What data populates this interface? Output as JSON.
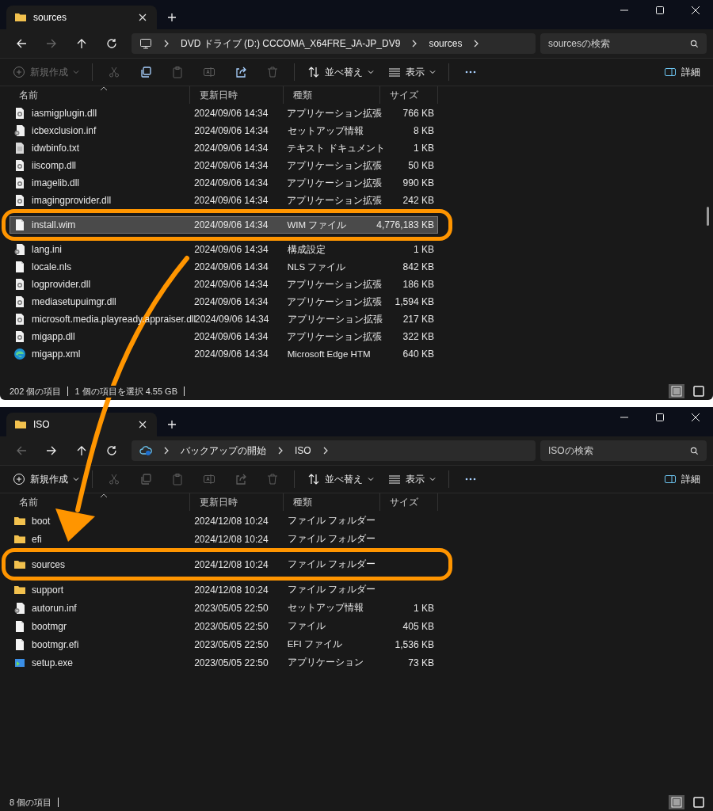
{
  "windows": [
    {
      "tab": {
        "title": "sources"
      },
      "back_disabled": false,
      "forward_disabled": true,
      "address": {
        "kind": "pc",
        "items": [
          "DVD ドライブ (D:) CCCOMA_X64FRE_JA-JP_DV9",
          "sources"
        ]
      },
      "search": {
        "placeholder": "sourcesの検索"
      },
      "toolbar": {
        "new": {
          "label": "新規作成",
          "disabled": true
        },
        "actions": [
          {
            "kind": "cut",
            "disabled": true
          },
          {
            "kind": "copy",
            "disabled": false
          },
          {
            "kind": "paste",
            "disabled": true
          },
          {
            "kind": "rename",
            "disabled": true
          },
          {
            "kind": "share",
            "disabled": false
          },
          {
            "kind": "delete",
            "disabled": true
          }
        ],
        "sort": "並べ替え",
        "view": "表示",
        "details": "詳細"
      },
      "columns": [
        "名前",
        "更新日時",
        "種類",
        "サイズ"
      ],
      "rows": [
        {
          "kind": "dll",
          "name": "iasmigplugin.dll",
          "date": "2024/09/06 14:34",
          "type": "アプリケーション拡張",
          "size": "766 KB",
          "selected": false
        },
        {
          "kind": "setup",
          "name": "icbexclusion.inf",
          "date": "2024/09/06 14:34",
          "type": "セットアップ情報",
          "size": "8 KB",
          "selected": false
        },
        {
          "kind": "text",
          "name": "idwbinfo.txt",
          "date": "2024/09/06 14:34",
          "type": "テキスト ドキュメント",
          "size": "1 KB",
          "selected": false
        },
        {
          "kind": "dll",
          "name": "iiscomp.dll",
          "date": "2024/09/06 14:34",
          "type": "アプリケーション拡張",
          "size": "50 KB",
          "selected": false
        },
        {
          "kind": "dll",
          "name": "imagelib.dll",
          "date": "2024/09/06 14:34",
          "type": "アプリケーション拡張",
          "size": "990 KB",
          "selected": false
        },
        {
          "kind": "dll",
          "name": "imagingprovider.dll",
          "date": "2024/09/06 14:34",
          "type": "アプリケーション拡張",
          "size": "242 KB",
          "selected": false
        },
        {
          "kind": "file",
          "name": "install.wim",
          "date": "2024/09/06 14:34",
          "type": "WIM ファイル",
          "size": "4,776,183 KB",
          "selected": true,
          "highlighted": true
        },
        {
          "kind": "setup",
          "name": "lang.ini",
          "date": "2024/09/06 14:34",
          "type": "構成設定",
          "size": "1 KB",
          "selected": false
        },
        {
          "kind": "file",
          "name": "locale.nls",
          "date": "2024/09/06 14:34",
          "type": "NLS ファイル",
          "size": "842 KB",
          "selected": false
        },
        {
          "kind": "dll",
          "name": "logprovider.dll",
          "date": "2024/09/06 14:34",
          "type": "アプリケーション拡張",
          "size": "186 KB",
          "selected": false
        },
        {
          "kind": "dll",
          "name": "mediasetupuimgr.dll",
          "date": "2024/09/06 14:34",
          "type": "アプリケーション拡張",
          "size": "1,594 KB",
          "selected": false
        },
        {
          "kind": "dll",
          "name": "microsoft.media.playready.appraiser.dll",
          "date": "2024/09/06 14:34",
          "type": "アプリケーション拡張",
          "size": "217 KB",
          "selected": false
        },
        {
          "kind": "dll",
          "name": "migapp.dll",
          "date": "2024/09/06 14:34",
          "type": "アプリケーション拡張",
          "size": "322 KB",
          "selected": false
        },
        {
          "kind": "edge",
          "name": "migapp.xml",
          "date": "2024/09/06 14:34",
          "type": "Microsoft Edge HTM",
          "size": "640 KB",
          "selected": false
        }
      ],
      "status": {
        "count": "202 個の項目",
        "selection": "1 個の項目を選択  4.55 GB",
        "views": [
          {
            "kind": "details",
            "selected": true
          },
          {
            "kind": "tiles",
            "selected": false
          }
        ]
      }
    },
    {
      "tab": {
        "title": "ISO"
      },
      "back_disabled": true,
      "forward_disabled": false,
      "address": {
        "kind": "cloud",
        "items": [
          "バックアップの開始",
          "ISO"
        ]
      },
      "search": {
        "placeholder": "ISOの検索"
      },
      "toolbar": {
        "new": {
          "label": "新規作成",
          "disabled": false
        },
        "actions": [
          {
            "kind": "cut",
            "disabled": true
          },
          {
            "kind": "copy",
            "disabled": true
          },
          {
            "kind": "paste",
            "disabled": true
          },
          {
            "kind": "rename",
            "disabled": true
          },
          {
            "kind": "share",
            "disabled": true
          },
          {
            "kind": "delete",
            "disabled": true
          }
        ],
        "sort": "並べ替え",
        "view": "表示",
        "details": "詳細"
      },
      "columns": [
        "名前",
        "更新日時",
        "種類",
        "サイズ"
      ],
      "rows": [
        {
          "kind": "folder",
          "name": "boot",
          "date": "2024/12/08 10:24",
          "type": "ファイル フォルダー",
          "selected": false
        },
        {
          "kind": "folder",
          "name": "efi",
          "date": "2024/12/08 10:24",
          "type": "ファイル フォルダー",
          "selected": false
        },
        {
          "kind": "folder",
          "name": "sources",
          "date": "2024/12/08 10:24",
          "type": "ファイル フォルダー",
          "selected": false,
          "highlighted": true
        },
        {
          "kind": "folder",
          "name": "support",
          "date": "2024/12/08 10:24",
          "type": "ファイル フォルダー",
          "selected": false
        },
        {
          "kind": "setup",
          "name": "autorun.inf",
          "date": "2023/05/05 22:50",
          "type": "セットアップ情報",
          "size": "1 KB",
          "selected": false
        },
        {
          "kind": "file",
          "name": "bootmgr",
          "date": "2023/05/05 22:50",
          "type": "ファイル",
          "size": "405 KB",
          "selected": false
        },
        {
          "kind": "file",
          "name": "bootmgr.efi",
          "date": "2023/05/05 22:50",
          "type": "EFI ファイル",
          "size": "1,536 KB",
          "selected": false
        },
        {
          "kind": "app",
          "name": "setup.exe",
          "date": "2023/05/05 22:50",
          "type": "アプリケーション",
          "size": "73 KB",
          "selected": false
        }
      ],
      "status": {
        "count": "8 個の項目",
        "views": [
          {
            "kind": "details",
            "selected": true
          },
          {
            "kind": "tiles",
            "selected": false
          }
        ]
      }
    }
  ]
}
